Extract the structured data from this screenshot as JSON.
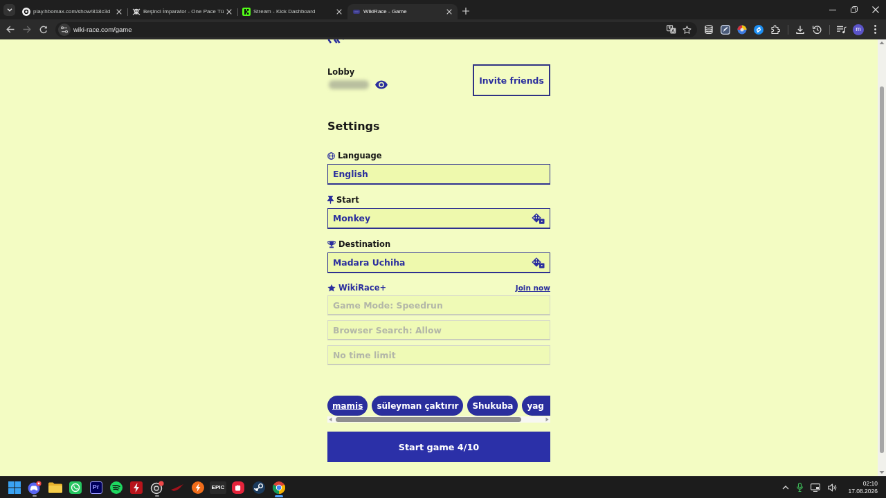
{
  "browser": {
    "tabs": [
      {
        "title": "play.hbomax.com/show/818c3d",
        "selected": false
      },
      {
        "title": "Beşinci İmparator - One Pace Tü",
        "selected": false
      },
      {
        "title": "Stream - Kick Dashboard",
        "selected": false
      },
      {
        "title": "WikiRace - Game",
        "selected": true
      }
    ],
    "address": "wiki-race.com/game",
    "forward_disabled": true,
    "profile_initial": "m"
  },
  "lobby": {
    "label": "Lobby",
    "invite_button": "Invite friends"
  },
  "settings": {
    "title": "Settings",
    "fields": [
      {
        "kind": "select",
        "label": "Language",
        "value": "English"
      },
      {
        "kind": "article",
        "label": "Start",
        "value": "Monkey"
      },
      {
        "kind": "article",
        "label": "Destination",
        "value": "Madara Uchiha"
      }
    ]
  },
  "plus": {
    "label": "WikiRace+",
    "link": "Join now",
    "options": [
      {
        "value": "Game Mode: Speedrun",
        "disabled": true
      },
      {
        "value": "Browser Search: Allow",
        "disabled": true
      },
      {
        "value": "No time limit",
        "disabled": true
      }
    ]
  },
  "players": [
    {
      "name": "mamis",
      "current": true
    },
    {
      "name": "süleyman çaktırır",
      "current": false
    },
    {
      "name": "Shukuba",
      "current": false
    },
    {
      "name": "yag",
      "current": false
    }
  ],
  "start_button": "Start game 4/10",
  "taskbar": {
    "tile_texts": [
      "Pr",
      "EPIC"
    ],
    "time": "02:10",
    "date": "17.08.2026"
  }
}
